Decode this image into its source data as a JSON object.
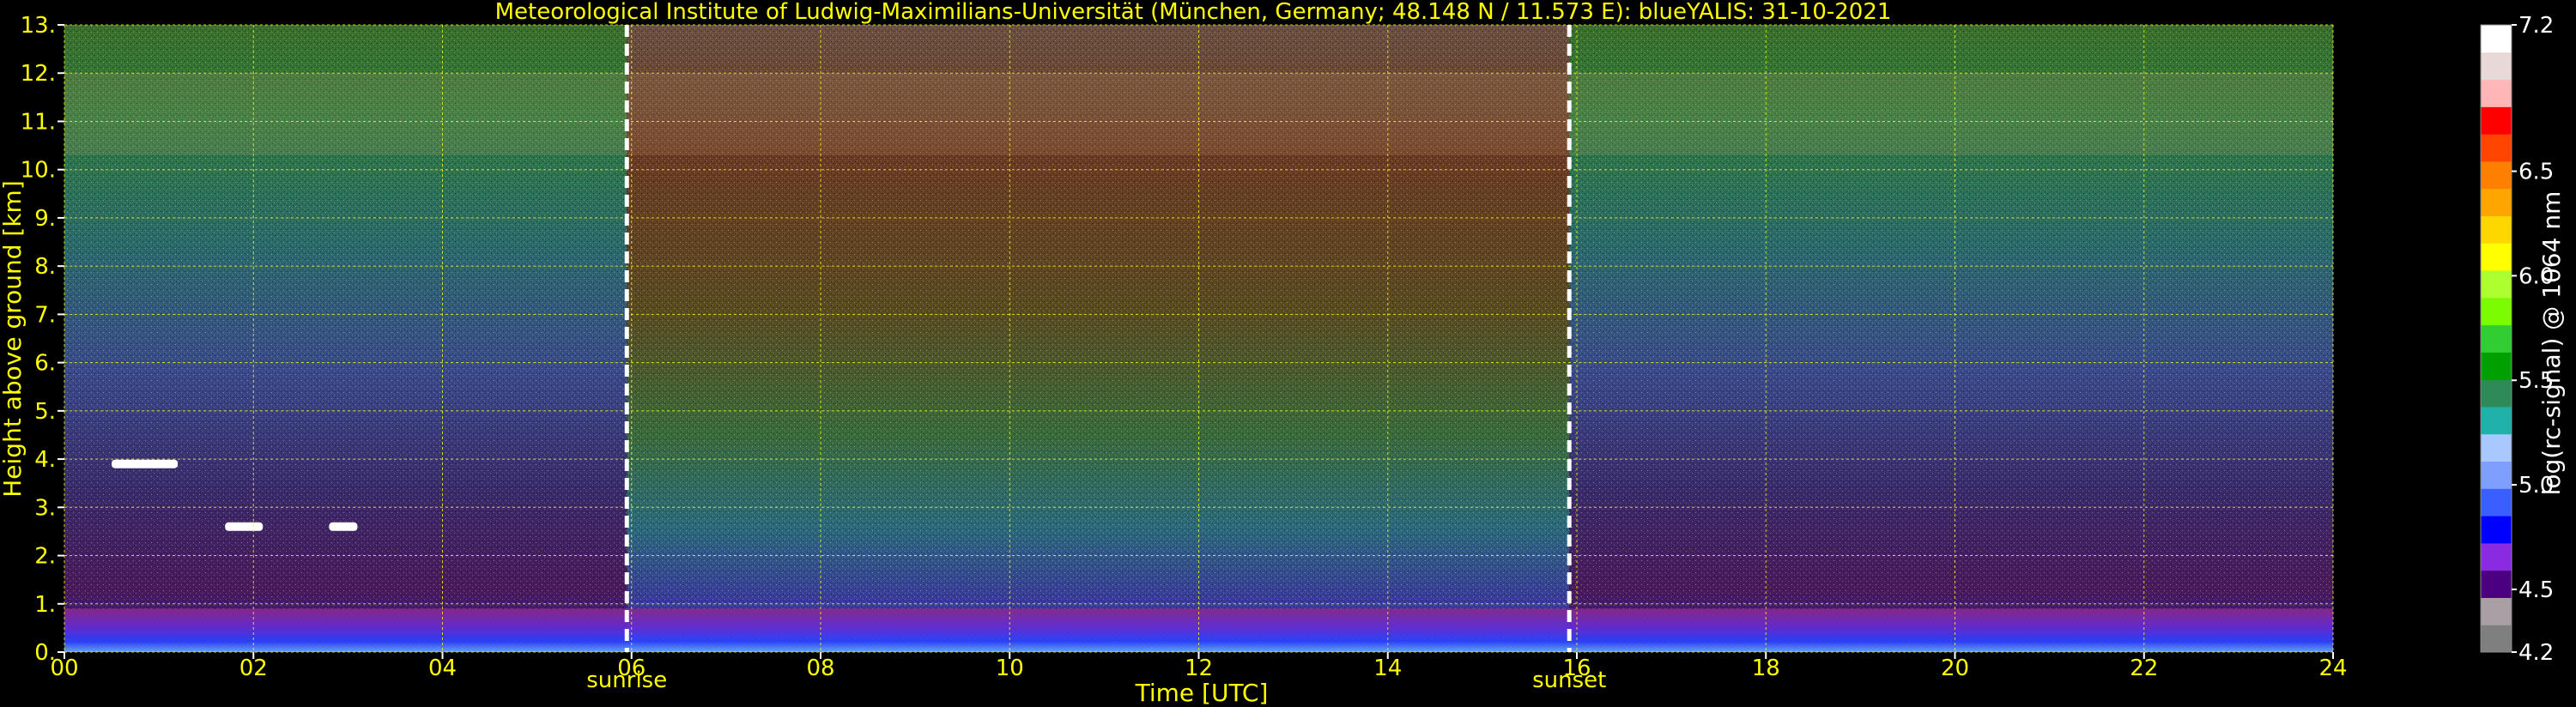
{
  "chart_data": {
    "type": "heatmap",
    "title": "Meteorological Institute of Ludwig-Maximilians-Universität (München, Germany; 48.148 N / 11.573 E):     blueYALIS: 31-10-2021",
    "xlabel": "Time [UTC]",
    "ylabel": "Height above ground [km]",
    "xlim": [
      0,
      24
    ],
    "ylim": [
      0,
      13
    ],
    "x_ticks": [
      "00",
      "02",
      "04",
      "06",
      "08",
      "10",
      "12",
      "14",
      "16",
      "18",
      "20",
      "22",
      "24"
    ],
    "y_ticks": [
      "0.",
      "1.",
      "2.",
      "3.",
      "4.",
      "5.",
      "6.",
      "7.",
      "8.",
      "9.",
      "10.",
      "11.",
      "12.",
      "13."
    ],
    "grid": true,
    "annotations": [
      {
        "label": "sunrise",
        "time": 5.95
      },
      {
        "label": "sunset",
        "time": 15.92
      }
    ],
    "colorbar": {
      "label": "log(rc-signal) @ 1064 nm",
      "range": [
        4.2,
        7.2
      ],
      "ticks": [
        "4.2",
        "4.5",
        "5.0",
        "5.5",
        "6.0",
        "6.5",
        "7.2"
      ],
      "colors": [
        "#7f7f7f",
        "#a9a0a6",
        "#4b0082",
        "#8a2be2",
        "#0000ff",
        "#3a5fff",
        "#7f9fff",
        "#a8c8ff",
        "#20b2aa",
        "#2e8b57",
        "#00a000",
        "#32cd32",
        "#7cfc00",
        "#adff2f",
        "#ffff00",
        "#ffd700",
        "#ffa500",
        "#ff7f00",
        "#ff4500",
        "#ff0000",
        "#ffb6b6",
        "#e8d8d8",
        "#ffffff"
      ]
    },
    "features": {
      "boundary_layer_top_km": 0.9,
      "cirrus_base_km": 10.3,
      "cirrus_top_km": 12.0,
      "low_clouds": [
        {
          "time_range": [
            0.5,
            1.2
          ],
          "height_km": 3.9
        },
        {
          "time_range": [
            1.7,
            2.1
          ],
          "height_km": 2.6
        },
        {
          "time_range": [
            2.8,
            3.1
          ],
          "height_km": 2.6
        }
      ]
    }
  }
}
